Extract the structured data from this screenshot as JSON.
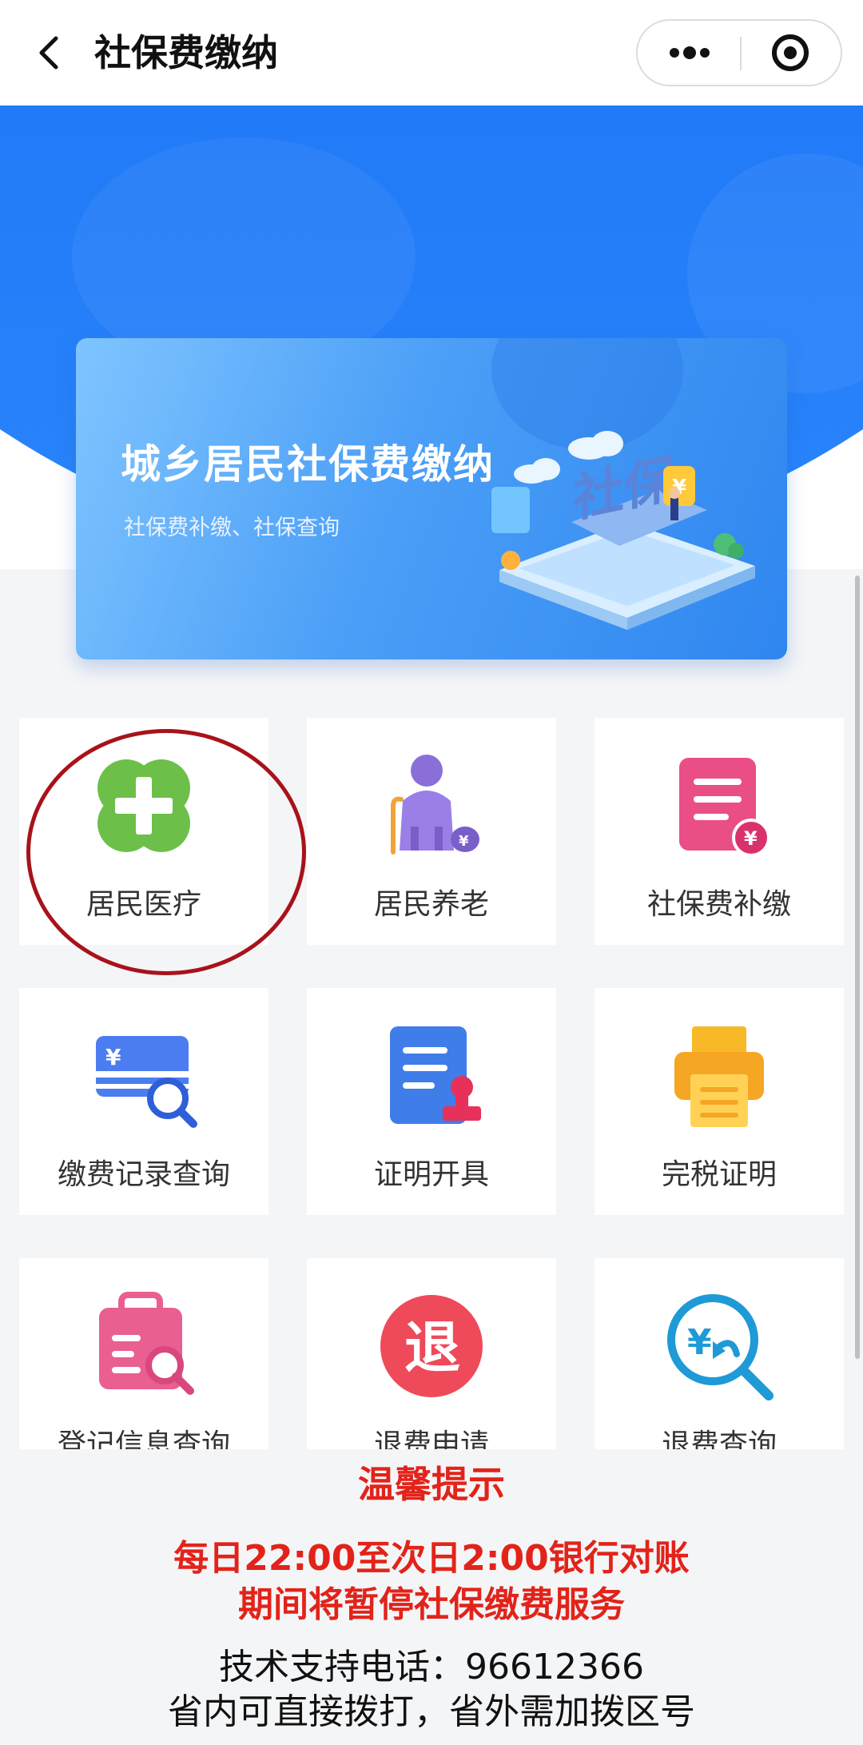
{
  "header": {
    "title": "社保费缴纳",
    "back_icon": "chevron-left-icon",
    "more_icon": "more-dots-icon",
    "close_icon": "target-close-icon"
  },
  "banner": {
    "title": "城乡居民社保费缴纳",
    "subtitle": "社保费补缴、社保查询",
    "art_text": "社保",
    "art_badge": "¥"
  },
  "grid": {
    "items": [
      {
        "label": "居民医疗",
        "icon": "green-cross-icon",
        "highlighted": true
      },
      {
        "label": "居民养老",
        "icon": "elderly-pension-icon"
      },
      {
        "label": "社保费补缴",
        "icon": "document-yuan-icon",
        "badge": "¥"
      },
      {
        "label": "缴费记录查询",
        "icon": "card-search-icon",
        "badge": "¥"
      },
      {
        "label": "证明开具",
        "icon": "document-stamp-icon"
      },
      {
        "label": "完税证明",
        "icon": "printer-icon"
      },
      {
        "label": "登记信息查询",
        "icon": "clipboard-search-icon"
      },
      {
        "label": "退费申请",
        "icon": "refund-badge-icon",
        "badge": "退"
      },
      {
        "label": "退费查询",
        "icon": "refund-search-icon",
        "badge": "¥"
      }
    ]
  },
  "notice": {
    "title": "温馨提示",
    "line1": "每日22:00至次日2:00银行对账",
    "line2": "期间将暂停社保缴费服务",
    "support": "技术支持电话：96612366",
    "dial_note": "省内可直接拨打，省外需加拨区号"
  },
  "colors": {
    "brand_blue": "#1f78f7",
    "notice_red": "#e2231a",
    "highlight_ring": "#a8121a"
  }
}
